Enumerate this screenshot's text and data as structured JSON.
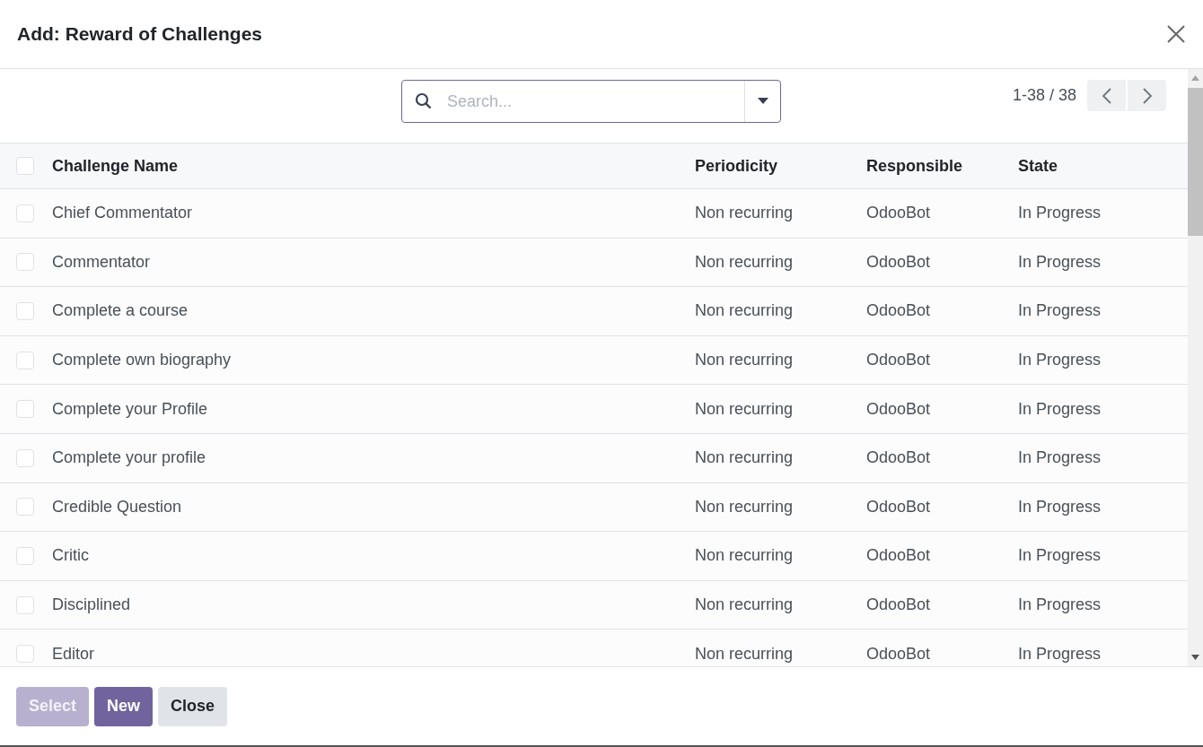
{
  "dialog": {
    "title": "Add: Reward of Challenges"
  },
  "search": {
    "placeholder": "Search..."
  },
  "pager": {
    "range": "1-38 / 38"
  },
  "table": {
    "header_checked": false,
    "columns": [
      "Challenge Name",
      "Periodicity",
      "Responsible",
      "State"
    ],
    "rows": [
      {
        "checked": false,
        "cells": [
          "Chief Commentator",
          "Non recurring",
          "OdooBot",
          "In Progress"
        ]
      },
      {
        "checked": false,
        "cells": [
          "Commentator",
          "Non recurring",
          "OdooBot",
          "In Progress"
        ]
      },
      {
        "checked": false,
        "cells": [
          "Complete a course",
          "Non recurring",
          "OdooBot",
          "In Progress"
        ]
      },
      {
        "checked": false,
        "cells": [
          "Complete own biography",
          "Non recurring",
          "OdooBot",
          "In Progress"
        ]
      },
      {
        "checked": false,
        "cells": [
          "Complete your Profile",
          "Non recurring",
          "OdooBot",
          "In Progress"
        ]
      },
      {
        "checked": false,
        "cells": [
          "Complete your profile",
          "Non recurring",
          "OdooBot",
          "In Progress"
        ]
      },
      {
        "checked": false,
        "cells": [
          "Credible Question",
          "Non recurring",
          "OdooBot",
          "In Progress"
        ]
      },
      {
        "checked": false,
        "cells": [
          "Critic",
          "Non recurring",
          "OdooBot",
          "In Progress"
        ]
      },
      {
        "checked": false,
        "cells": [
          "Disciplined",
          "Non recurring",
          "OdooBot",
          "In Progress"
        ]
      },
      {
        "checked": false,
        "cells": [
          "Editor",
          "Non recurring",
          "OdooBot",
          "In Progress"
        ]
      }
    ]
  },
  "buttons": [
    {
      "label": "Select",
      "kind": "primary",
      "disabled": true
    },
    {
      "label": "New",
      "kind": "primary",
      "disabled": false
    },
    {
      "label": "Close",
      "kind": "secondary",
      "disabled": false
    }
  ]
}
